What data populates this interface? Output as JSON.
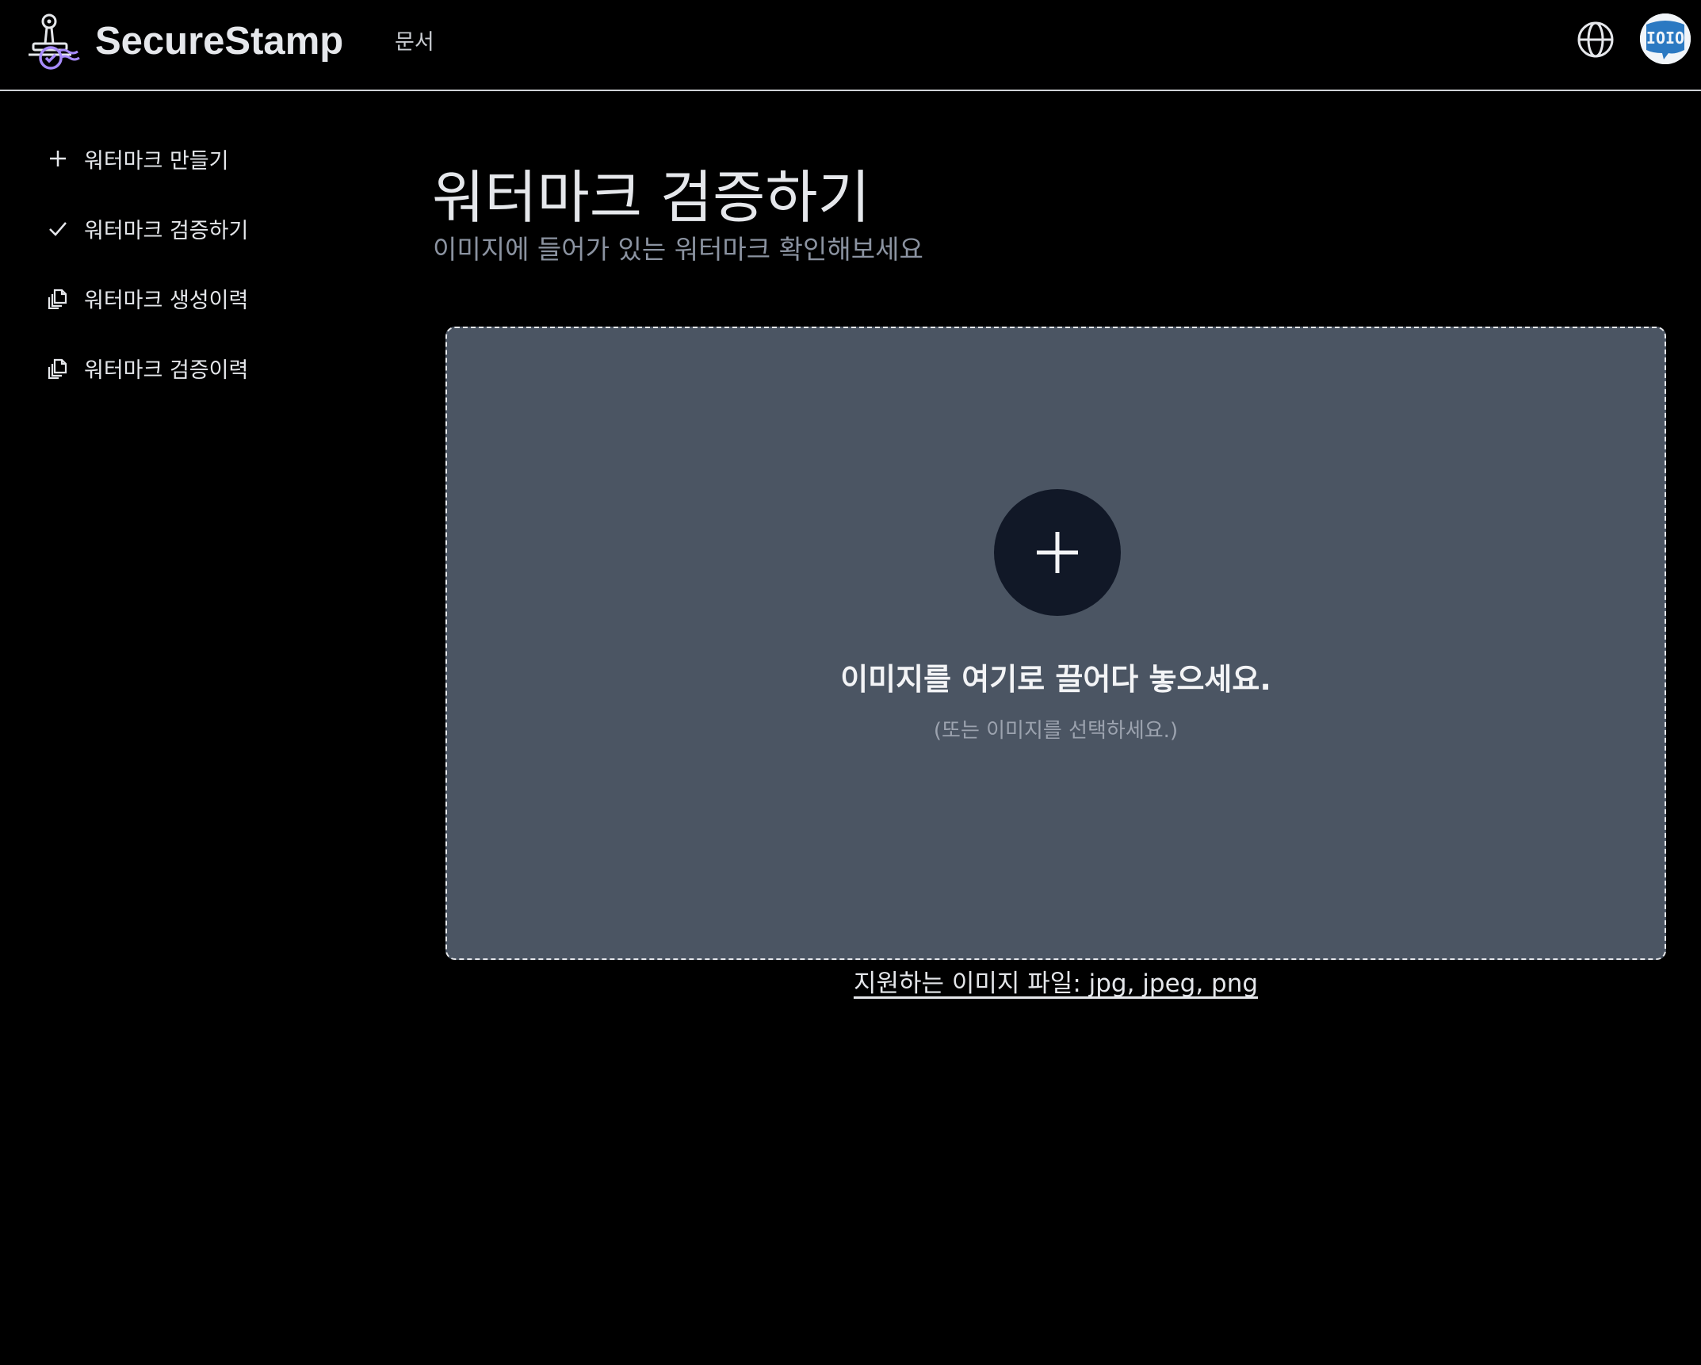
{
  "header": {
    "brand_name": "SecureStamp",
    "docs_label": "문서",
    "language_icon": "globe-icon",
    "avatar_text": "IOIO"
  },
  "sidebar": {
    "items": [
      {
        "icon": "plus-icon",
        "label": "워터마크 만들기"
      },
      {
        "icon": "check-icon",
        "label": "워터마크 검증하기"
      },
      {
        "icon": "copy-icon",
        "label": "워터마크 생성이력"
      },
      {
        "icon": "copy-icon",
        "label": "워터마크 검증이력"
      }
    ]
  },
  "main": {
    "title": "워터마크 검증하기",
    "subtitle": "이미지에 들어가 있는 워터마크 확인해보세요",
    "dropzone": {
      "icon": "plus-icon",
      "title": "이미지를 여기로 끌어다 놓으세요.",
      "subtitle": "(또는 이미지를 선택하세요.)"
    },
    "supported_formats": "지원하는 이미지 파일: jpg, jpeg, png"
  },
  "colors": {
    "background": "#000000",
    "dropzone_bg": "#4b5563",
    "plus_circle_bg": "#111827",
    "logo_accent": "#a78bfa",
    "avatar_blue": "#2b79c2",
    "text_primary": "#e5e7eb",
    "text_muted": "#8b93a1"
  }
}
